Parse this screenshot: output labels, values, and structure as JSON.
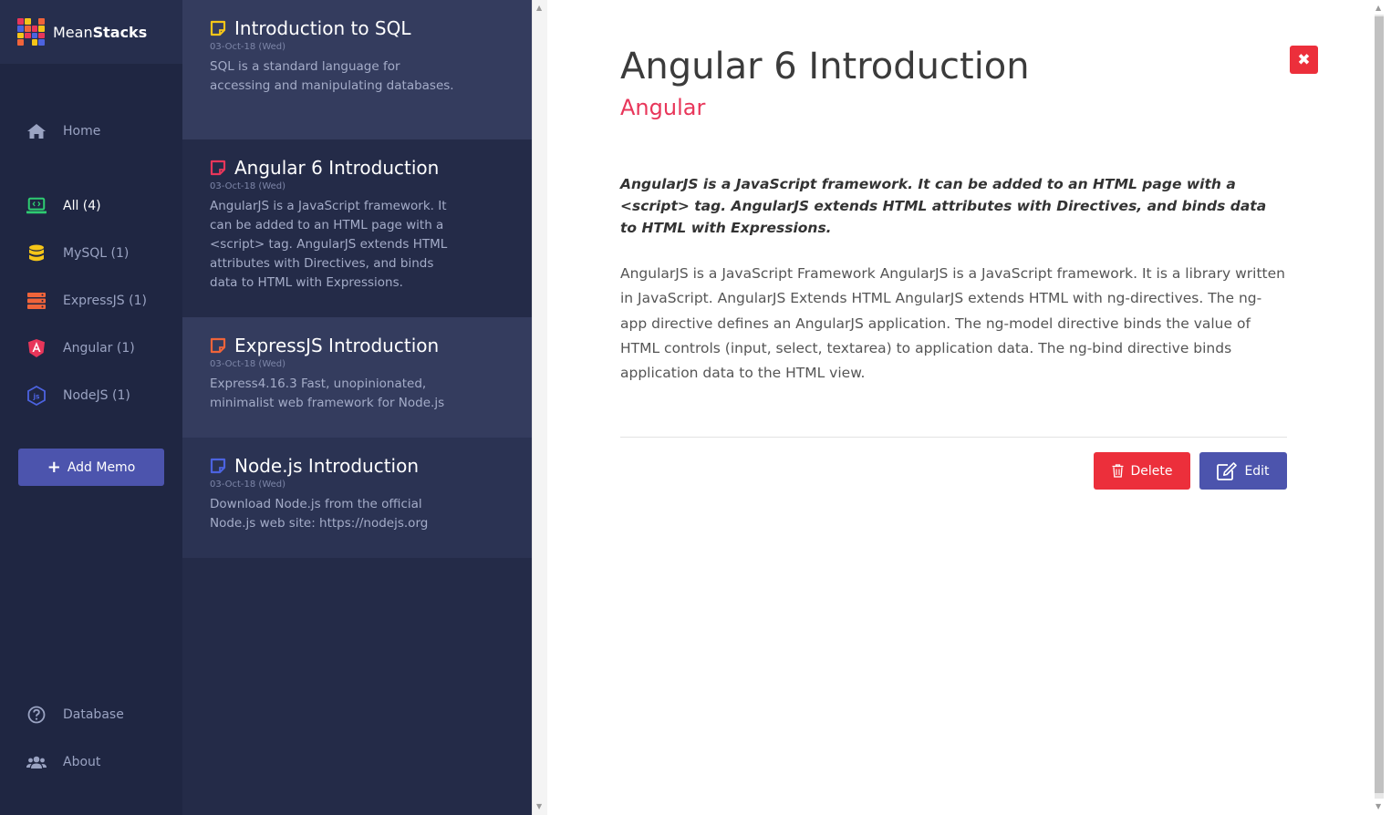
{
  "brand": {
    "name_light": "Mean",
    "name_bold": "Stacks"
  },
  "sidebar": {
    "home": {
      "label": "Home",
      "icon": "home-icon"
    },
    "categories": [
      {
        "label": "All (4)",
        "icon": "laptop-code-icon",
        "color": "#2ecc71",
        "active": true
      },
      {
        "label": "MySQL (1)",
        "icon": "database-icon",
        "color": "#f5c518"
      },
      {
        "label": "ExpressJS (1)",
        "icon": "server-icon",
        "color": "#f0643a"
      },
      {
        "label": "Angular (1)",
        "icon": "angular-icon",
        "color": "#e8365a"
      },
      {
        "label": "NodeJS (1)",
        "icon": "nodejs-icon",
        "color": "#4c63e0"
      }
    ],
    "add_memo_label": "Add Memo",
    "footer": [
      {
        "label": "Database",
        "icon": "question-circle-icon"
      },
      {
        "label": "About",
        "icon": "users-icon"
      }
    ]
  },
  "memos": [
    {
      "title": "Introduction to SQL",
      "date": "03-Oct-18 (Wed)",
      "excerpt": "SQL is a standard language for accessing and manipulating databases.",
      "color": "#f5c518"
    },
    {
      "title": "Angular 6 Introduction",
      "date": "03-Oct-18 (Wed)",
      "excerpt": "AngularJS is a JavaScript framework. It can be added to an HTML page with a <script> tag. AngularJS extends HTML attributes with Directives, and binds data to HTML with Expressions.",
      "color": "#e8365a"
    },
    {
      "title": "ExpressJS Introduction",
      "date": "03-Oct-18 (Wed)",
      "excerpt": "Express4.16.3 Fast, unopinionated, minimalist web framework for Node.js",
      "color": "#f0643a"
    },
    {
      "title": "Node.js Introduction",
      "date": "03-Oct-18 (Wed)",
      "excerpt": "Download Node.js from the official Node.js web site: https://nodejs.org",
      "color": "#4c63e0"
    }
  ],
  "detail": {
    "title": "Angular 6 Introduction",
    "category": "Angular",
    "lead": "AngularJS is a JavaScript framework. It can be added to an HTML page with a <script> tag. AngularJS extends HTML attributes with Directives, and binds data to HTML with Expressions.",
    "body": "AngularJS is a JavaScript Framework AngularJS is a JavaScript framework. It is a library written in JavaScript. AngularJS Extends HTML AngularJS extends HTML with ng-directives. The ng-app directive defines an AngularJS application. The ng-model directive binds the value of HTML controls (input, select, textarea) to application data. The ng-bind directive binds application data to the HTML view.",
    "close_symbol": "✖",
    "delete_label": "Delete",
    "edit_label": "Edit"
  },
  "colors": {
    "accent": "#4c54ad",
    "danger": "#ec2f3b",
    "category": "#e8365a",
    "sidebar_bg": "#1f2642",
    "list_bg": "#242b48"
  }
}
